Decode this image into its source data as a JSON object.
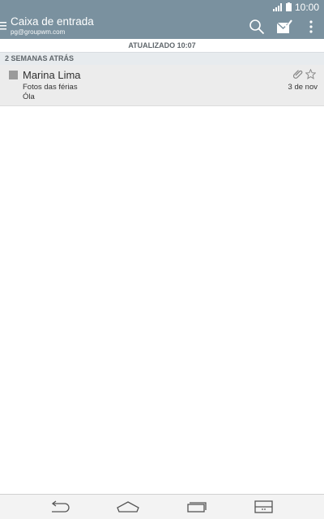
{
  "status_bar": {
    "time": "10:00"
  },
  "app_bar": {
    "title": "Caixa de entrada",
    "account": "pg@groupwm.com",
    "icons": [
      "menu-icon",
      "search-icon",
      "select-mail-icon",
      "more-vert-icon"
    ]
  },
  "updated_label": "ATUALIZADO 10:07",
  "section": {
    "label": "2 SEMANAS ATRÁS"
  },
  "messages": [
    {
      "sender": "Marina Lima",
      "subject": "Fotos das férias",
      "preview": "Óla",
      "date": "3 de nov",
      "has_attachment": true,
      "starred": false
    }
  ],
  "nav_bar": {
    "icons": [
      "back-icon",
      "home-icon",
      "recent-apps-icon",
      "dual-window-icon"
    ]
  },
  "colors": {
    "app_bar": "#7a919f",
    "section_header": "#e7ebee",
    "item_bg": "#ececec"
  }
}
